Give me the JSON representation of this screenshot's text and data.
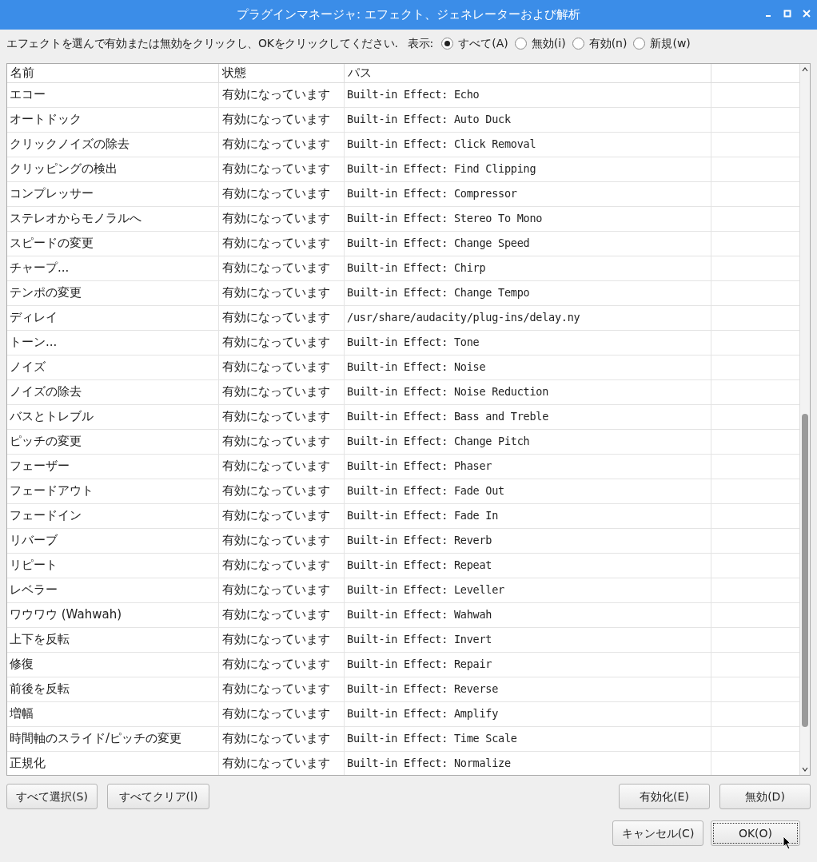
{
  "window": {
    "title": "プラグインマネージャ: エフェクト、ジェネレーターおよび解析"
  },
  "instruction": "エフェクトを選んで有効または無効をクリックし、OKをクリックしてください.",
  "filter": {
    "label": "表示:",
    "options": [
      {
        "label": "すべて(A)",
        "selected": true
      },
      {
        "label": "無効(i)",
        "selected": false
      },
      {
        "label": "有効(n)",
        "selected": false
      },
      {
        "label": "新規(w)",
        "selected": false
      }
    ]
  },
  "table": {
    "columns": [
      "名前",
      "状態",
      "パス"
    ],
    "rows": [
      {
        "name": "エコー",
        "status": "有効になっています",
        "path": "Built-in Effect: Echo"
      },
      {
        "name": "オートドック",
        "status": "有効になっています",
        "path": "Built-in Effect: Auto Duck"
      },
      {
        "name": "クリックノイズの除去",
        "status": "有効になっています",
        "path": "Built-in Effect: Click Removal"
      },
      {
        "name": "クリッピングの検出",
        "status": "有効になっています",
        "path": "Built-in Effect: Find Clipping"
      },
      {
        "name": "コンプレッサー",
        "status": "有効になっています",
        "path": "Built-in Effect: Compressor"
      },
      {
        "name": "ステレオからモノラルへ",
        "status": "有効になっています",
        "path": "Built-in Effect: Stereo To Mono"
      },
      {
        "name": "スピードの変更",
        "status": "有効になっています",
        "path": "Built-in Effect: Change Speed"
      },
      {
        "name": "チャープ...",
        "status": "有効になっています",
        "path": "Built-in Effect: Chirp"
      },
      {
        "name": "テンポの変更",
        "status": "有効になっています",
        "path": "Built-in Effect: Change Tempo"
      },
      {
        "name": "ディレイ",
        "status": "有効になっています",
        "path": "/usr/share/audacity/plug-ins/delay.ny"
      },
      {
        "name": "トーン...",
        "status": "有効になっています",
        "path": "Built-in Effect: Tone"
      },
      {
        "name": "ノイズ",
        "status": "有効になっています",
        "path": "Built-in Effect: Noise"
      },
      {
        "name": "ノイズの除去",
        "status": "有効になっています",
        "path": "Built-in Effect: Noise Reduction"
      },
      {
        "name": "バスとトレブル",
        "status": "有効になっています",
        "path": "Built-in Effect: Bass and Treble"
      },
      {
        "name": "ピッチの変更",
        "status": "有効になっています",
        "path": "Built-in Effect: Change Pitch"
      },
      {
        "name": "フェーザー",
        "status": "有効になっています",
        "path": "Built-in Effect: Phaser"
      },
      {
        "name": "フェードアウト",
        "status": "有効になっています",
        "path": "Built-in Effect: Fade Out"
      },
      {
        "name": "フェードイン",
        "status": "有効になっています",
        "path": "Built-in Effect: Fade In"
      },
      {
        "name": "リバーブ",
        "status": "有効になっています",
        "path": "Built-in Effect: Reverb"
      },
      {
        "name": "リピート",
        "status": "有効になっています",
        "path": "Built-in Effect: Repeat"
      },
      {
        "name": "レベラー",
        "status": "有効になっています",
        "path": "Built-in Effect: Leveller"
      },
      {
        "name": "ワウワウ (Wahwah)",
        "status": "有効になっています",
        "path": "Built-in Effect: Wahwah"
      },
      {
        "name": "上下を反転",
        "status": "有効になっています",
        "path": "Built-in Effect: Invert"
      },
      {
        "name": "修復",
        "status": "有効になっています",
        "path": "Built-in Effect: Repair"
      },
      {
        "name": "前後を反転",
        "status": "有効になっています",
        "path": "Built-in Effect: Reverse"
      },
      {
        "name": "増幅",
        "status": "有効になっています",
        "path": "Built-in Effect: Amplify"
      },
      {
        "name": "時間軸のスライド/ピッチの変更",
        "status": "有効になっています",
        "path": "Built-in Effect: Time Scale"
      },
      {
        "name": "正規化",
        "status": "有効になっています",
        "path": "Built-in Effect: Normalize"
      }
    ]
  },
  "left_buttons": [
    "すべて選択(S)",
    "すべてクリア(l)"
  ],
  "right_buttons": [
    "有効化(E)",
    "無効(D)"
  ],
  "dialog_buttons": [
    {
      "label": "キャンセル(C)",
      "selected": false
    },
    {
      "label": "OK(O)",
      "selected": true
    }
  ]
}
